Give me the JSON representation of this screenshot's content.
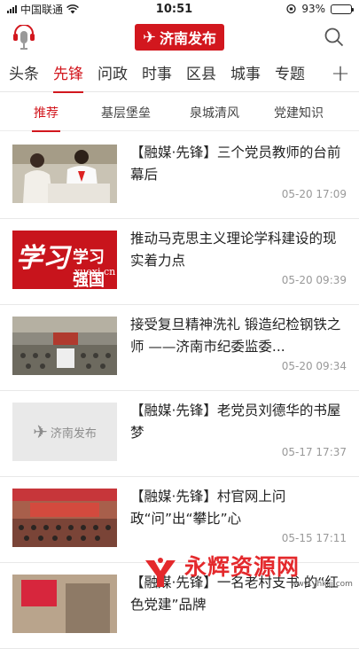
{
  "status_bar": {
    "carrier": "中国联通",
    "time": "10:51",
    "battery": "93%",
    "battery_level": 0.93
  },
  "header": {
    "logo_text": "济南发布"
  },
  "channels": [
    "头条",
    "先锋",
    "问政",
    "时事",
    "区县",
    "城事",
    "专题"
  ],
  "active_channel": 1,
  "plus_label": "+",
  "subtabs": [
    "推荐",
    "基层堡垒",
    "泉城清风",
    "党建知识"
  ],
  "active_subtab": 0,
  "news": [
    {
      "title": "【融媒·先锋】三个党员教师的台前幕后",
      "time": "05-20 17:09",
      "thumb": "teachers-photo"
    },
    {
      "title": "推动马克思主义理论学科建设的现实着力点",
      "time": "05-20 09:39",
      "thumb": "xuexi-logo",
      "thumb_text": "学习强国",
      "thumb_sub": "xuexi.cn"
    },
    {
      "title": "接受复旦精神洗礼 锻造纪检钢铁之师 ——济南市纪委监委...",
      "time": "05-20 09:34",
      "thumb": "meeting-hall-photo"
    },
    {
      "title": "【融媒·先锋】老党员刘德华的书屋梦",
      "time": "05-17 17:37",
      "thumb": "jinan-fabu-placeholder",
      "thumb_text": "济南发布"
    },
    {
      "title": "【融媒·先锋】村官网上问政“问”出“攀比”心",
      "time": "05-15 17:11",
      "thumb": "auditorium-photo"
    },
    {
      "title": "【融媒·先锋】一名老村支书 的“红色党建”品牌",
      "time": "",
      "thumb": "partial-photo"
    }
  ],
  "watermark": {
    "text": "永辉资源网",
    "url": "www.yhkjjj.com"
  },
  "colors": {
    "brand_red": "#d2171e",
    "text": "#222222",
    "muted": "#999999"
  }
}
